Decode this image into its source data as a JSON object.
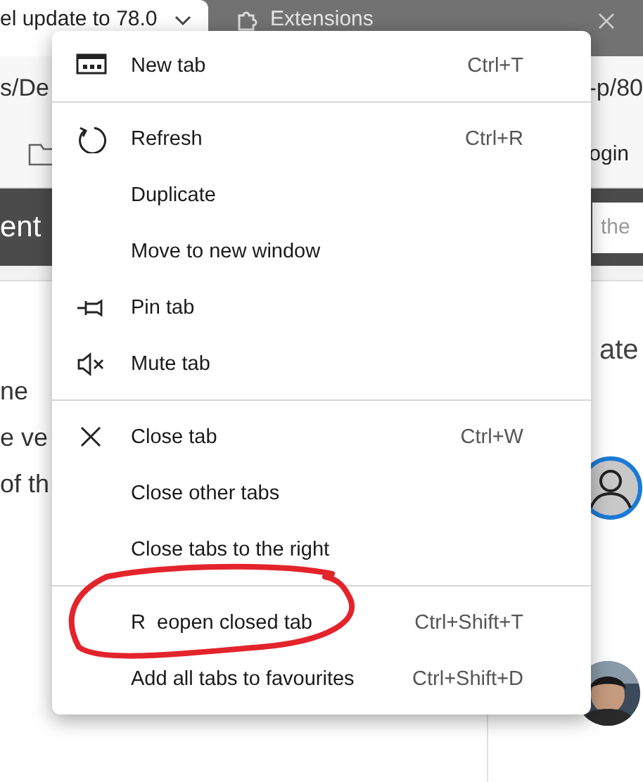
{
  "browser": {
    "tabs": [
      {
        "title": "el update to 78.0",
        "selected": true
      },
      {
        "title": "Extensions",
        "selected": false
      }
    ],
    "address_left": "s/De",
    "address_right": "-p/80",
    "bookmarks_right": "ogin",
    "site_header": {
      "title": "ent",
      "search_placeholder": "the"
    },
    "article_lines": [
      "ne",
      "e ve",
      "of th"
    ],
    "sidebar_heading": "ate"
  },
  "context_menu": {
    "groups": [
      {
        "items": [
          {
            "label": "New tab",
            "shortcut": "Ctrl+T"
          }
        ]
      },
      {
        "items": [
          {
            "label": "Refresh",
            "shortcut": "Ctrl+R"
          },
          {
            "label": "Duplicate"
          },
          {
            "label": "Move to new window"
          },
          {
            "label": "Pin tab"
          },
          {
            "label": "Mute tab"
          }
        ]
      },
      {
        "items": [
          {
            "label": "Close tab",
            "shortcut": "Ctrl+W"
          },
          {
            "label": "Close other tabs"
          },
          {
            "label": "Close tabs to the right"
          }
        ]
      },
      {
        "items": [
          {
            "label": "R  eopen closed tab",
            "shortcut": "Ctrl+Shift+T"
          },
          {
            "label": "Add all tabs to favourites",
            "shortcut": "Ctrl+Shift+D"
          }
        ]
      }
    ]
  }
}
